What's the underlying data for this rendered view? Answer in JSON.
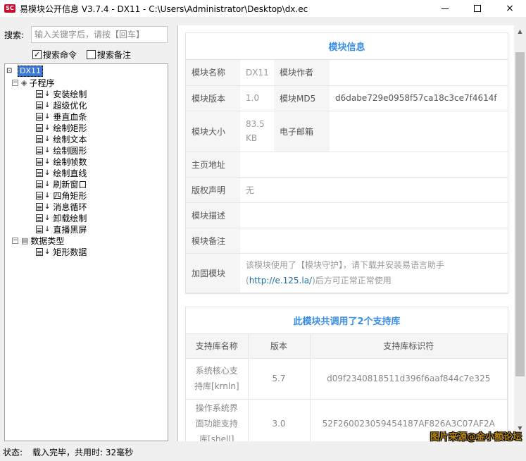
{
  "window": {
    "icon_text": "SC",
    "title": "易模块公开信息 V3.7.4 - DX11 - C:\\Users\\Administrator\\Desktop\\dx.ec",
    "controls": {
      "minimize": "minimize-icon",
      "maximize": "maximize-icon",
      "close": "×"
    }
  },
  "search": {
    "label": "搜索:",
    "placeholder": "输入关键字后，请按【回车】",
    "value": "",
    "options": [
      {
        "label": "搜索命令",
        "checked": true,
        "mark": "✓"
      },
      {
        "label": "搜索备注",
        "checked": false,
        "mark": ""
      }
    ]
  },
  "tree": {
    "root": "DX11",
    "groups": [
      {
        "label": "子程序",
        "toggle": "−",
        "items": [
          "安装绘制",
          "超级优化",
          "垂直血条",
          "绘制矩形",
          "绘制文本",
          "绘制圆形",
          "绘制帧数",
          "绘制直线",
          "刷新窗口",
          "四角矩形",
          "消息循环",
          "卸载绘制",
          "直播黑屏"
        ]
      },
      {
        "label": "数据类型",
        "toggle": "−",
        "items": [
          "矩形数据"
        ]
      }
    ]
  },
  "module_info": {
    "title": "模块信息",
    "name_key": "模块名称",
    "name_val": "DX11",
    "author_key": "模块作者",
    "author_val": "",
    "version_key": "模块版本",
    "version_val": "1.0",
    "md5_key": "模块MD5",
    "md5_val": "d6dabe729e0958f57ca18c3ce7f4614f",
    "size_key": "模块大小",
    "size_val": "83.5 KB",
    "email_key": "电子邮箱",
    "email_val": "",
    "homepage_key": "主页地址",
    "homepage_val": "",
    "copyright_key": "版权声明",
    "copyright_val": "无",
    "desc_key": "模块描述",
    "desc_val": "",
    "note_key": "模块备注",
    "note_val": "",
    "protect_key": "加固模块",
    "protect_text": "该模块使用了【模块守护】，请下载并安装易语言助手(",
    "protect_link": "http://e.125.la/",
    "protect_tail": ")后方可正常正常使用"
  },
  "libs": {
    "title": "此模块共调用了2个支持库",
    "headers": [
      "支持库名称",
      "版本",
      "支持库标识符"
    ],
    "rows": [
      {
        "name": "系统核心支持库[krnln]",
        "version": "5.7",
        "id": "d09f2340818511d396f6aaf844c7e325"
      },
      {
        "name": "操作系统界面功能支持库[shell]",
        "version": "3.0",
        "id": "52F260023059454187AF826A3C07AF2A"
      }
    ]
  },
  "status": {
    "label": "状态:",
    "text": "载入完毕，共用时: 32毫秒"
  },
  "watermark": "图片来源@金小额论坛"
}
